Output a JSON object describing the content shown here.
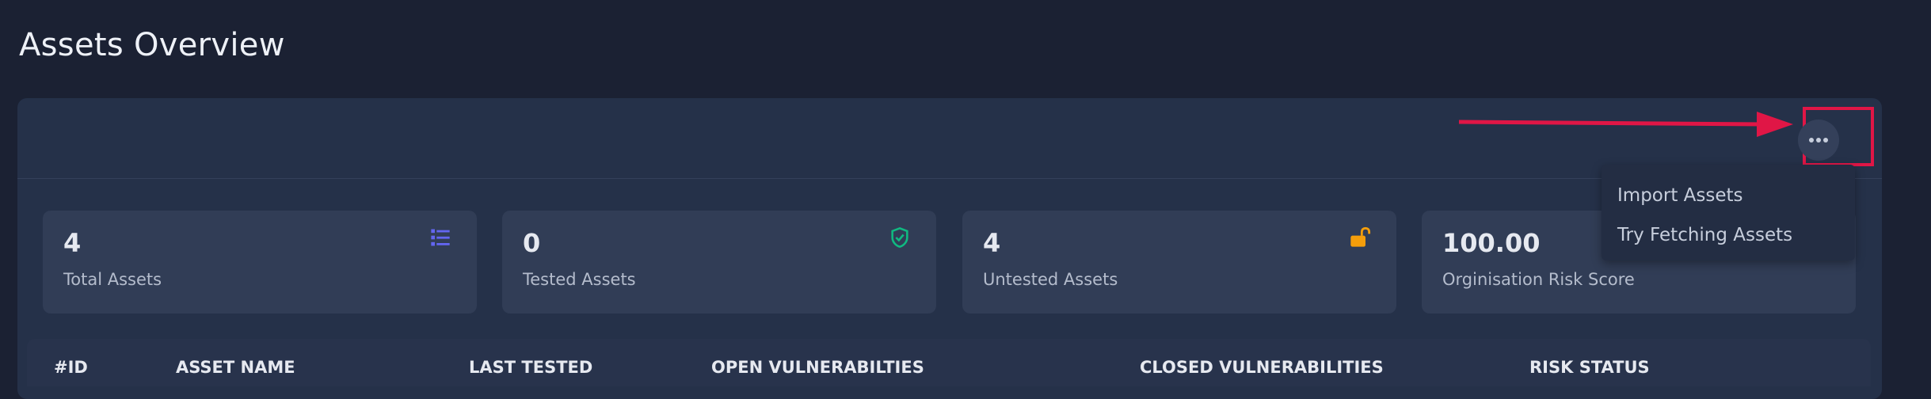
{
  "page": {
    "title": "Assets Overview"
  },
  "menu": {
    "items": [
      {
        "label": "Import Assets"
      },
      {
        "label": "Try Fetching Assets"
      }
    ]
  },
  "stats": [
    {
      "value": "4",
      "label": "Total Assets",
      "icon": "list-icon",
      "icon_color": "#6366f1"
    },
    {
      "value": "0",
      "label": "Tested Assets",
      "icon": "shield-check-icon",
      "icon_color": "#10b981"
    },
    {
      "value": "4",
      "label": "Untested Assets",
      "icon": "unlock-icon",
      "icon_color": "#f59e0b"
    },
    {
      "value": "100.00",
      "label": "Orginisation Risk Score",
      "icon": "",
      "icon_color": ""
    }
  ],
  "table": {
    "headers": [
      "#ID",
      "ASSET NAME",
      "LAST TESTED",
      "OPEN VULNERABILTIES",
      "CLOSED VULNERABILITIES",
      "RISK STATUS"
    ]
  },
  "colors": {
    "background": "#1b2133",
    "card": "#253149",
    "annotation": "#e01646"
  }
}
